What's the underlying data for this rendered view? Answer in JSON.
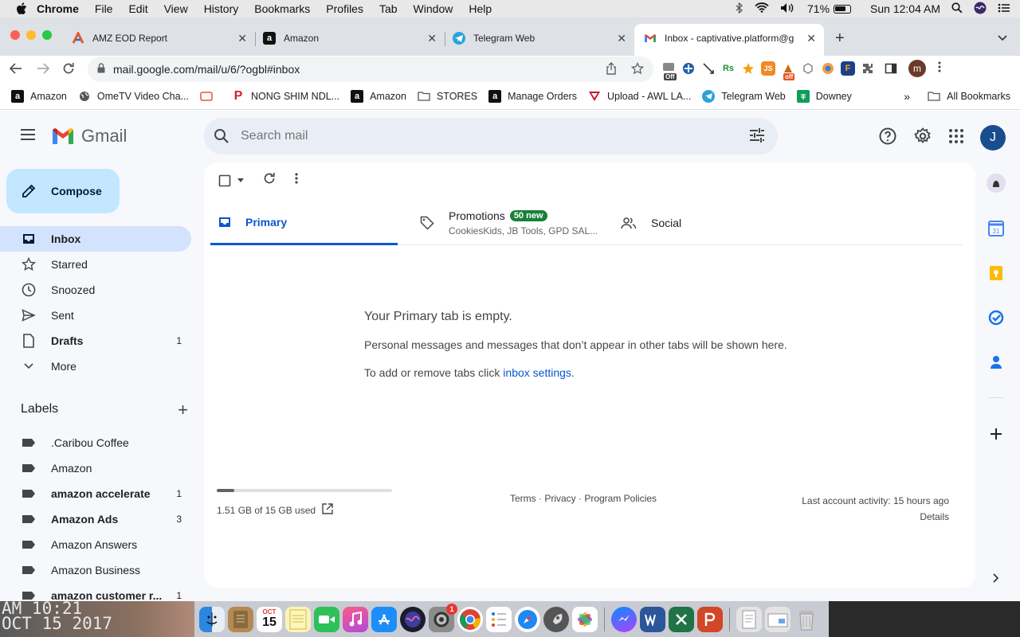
{
  "menubar": {
    "app": "Chrome",
    "items": [
      "File",
      "Edit",
      "View",
      "History",
      "Bookmarks",
      "Profiles",
      "Tab",
      "Window",
      "Help"
    ],
    "battery": "71%",
    "clock": "Sun 12:04 AM"
  },
  "tabs": [
    {
      "title": "AMZ EOD Report"
    },
    {
      "title": "Amazon"
    },
    {
      "title": "Telegram Web"
    },
    {
      "title": "Inbox - captivative.platform@g"
    }
  ],
  "address": {
    "url": "mail.google.com/mail/u/6/?ogbl#inbox"
  },
  "extensions": {
    "off1": "Off",
    "js": "JS",
    "off2": "off",
    "profile_initial": "m"
  },
  "bookmarks": [
    {
      "label": "Amazon"
    },
    {
      "label": "OmeTV Video Cha..."
    },
    {
      "label": "NONG SHIM NDL..."
    },
    {
      "label": "Amazon"
    },
    {
      "label": "STORES"
    },
    {
      "label": "Manage Orders"
    },
    {
      "label": "Upload - AWL LA..."
    },
    {
      "label": "Telegram Web"
    },
    {
      "label": "Downey"
    }
  ],
  "bookmarks_all": "All Bookmarks",
  "gmail": {
    "logo": "Gmail",
    "search_placeholder": "Search mail",
    "avatar": "J",
    "compose": "Compose",
    "nav": [
      {
        "label": "Inbox",
        "count": ""
      },
      {
        "label": "Starred",
        "count": ""
      },
      {
        "label": "Snoozed",
        "count": ""
      },
      {
        "label": "Sent",
        "count": ""
      },
      {
        "label": "Drafts",
        "count": "1"
      },
      {
        "label": "More",
        "count": ""
      }
    ],
    "labels_title": "Labels",
    "labels": [
      {
        "label": ".Caribou Coffee",
        "count": ""
      },
      {
        "label": "Amazon",
        "count": ""
      },
      {
        "label": "amazon accelerate",
        "count": "1"
      },
      {
        "label": "Amazon Ads",
        "count": "3"
      },
      {
        "label": "Amazon Answers",
        "count": ""
      },
      {
        "label": "Amazon Business",
        "count": ""
      },
      {
        "label": "amazon customer r...",
        "count": "1"
      }
    ],
    "inbox_tabs": {
      "primary": "Primary",
      "promotions": "Promotions",
      "promotions_badge": "50 new",
      "promotions_sub": "CookiesKids, JB Tools, GPD SAL...",
      "social": "Social"
    },
    "empty": {
      "title": "Your Primary tab is empty.",
      "body": "Personal messages and messages that don’t appear in other tabs will be shown here.",
      "settings_prefix": "To add or remove tabs click ",
      "settings_link": "inbox settings",
      "settings_suffix": "."
    },
    "footer": {
      "storage": "1.51 GB of 15 GB used",
      "storage_fraction": 0.1,
      "terms": "Terms · Privacy · Program Policies",
      "activity": "Last account activity: 15 hours ago",
      "details": "Details"
    }
  },
  "wallpaper_text": {
    "line1": "AM 10:21",
    "line2": "OCT 15 2017"
  },
  "dock": {
    "calendar_day": "15",
    "calendar_month": "OCT",
    "badge": "1"
  }
}
